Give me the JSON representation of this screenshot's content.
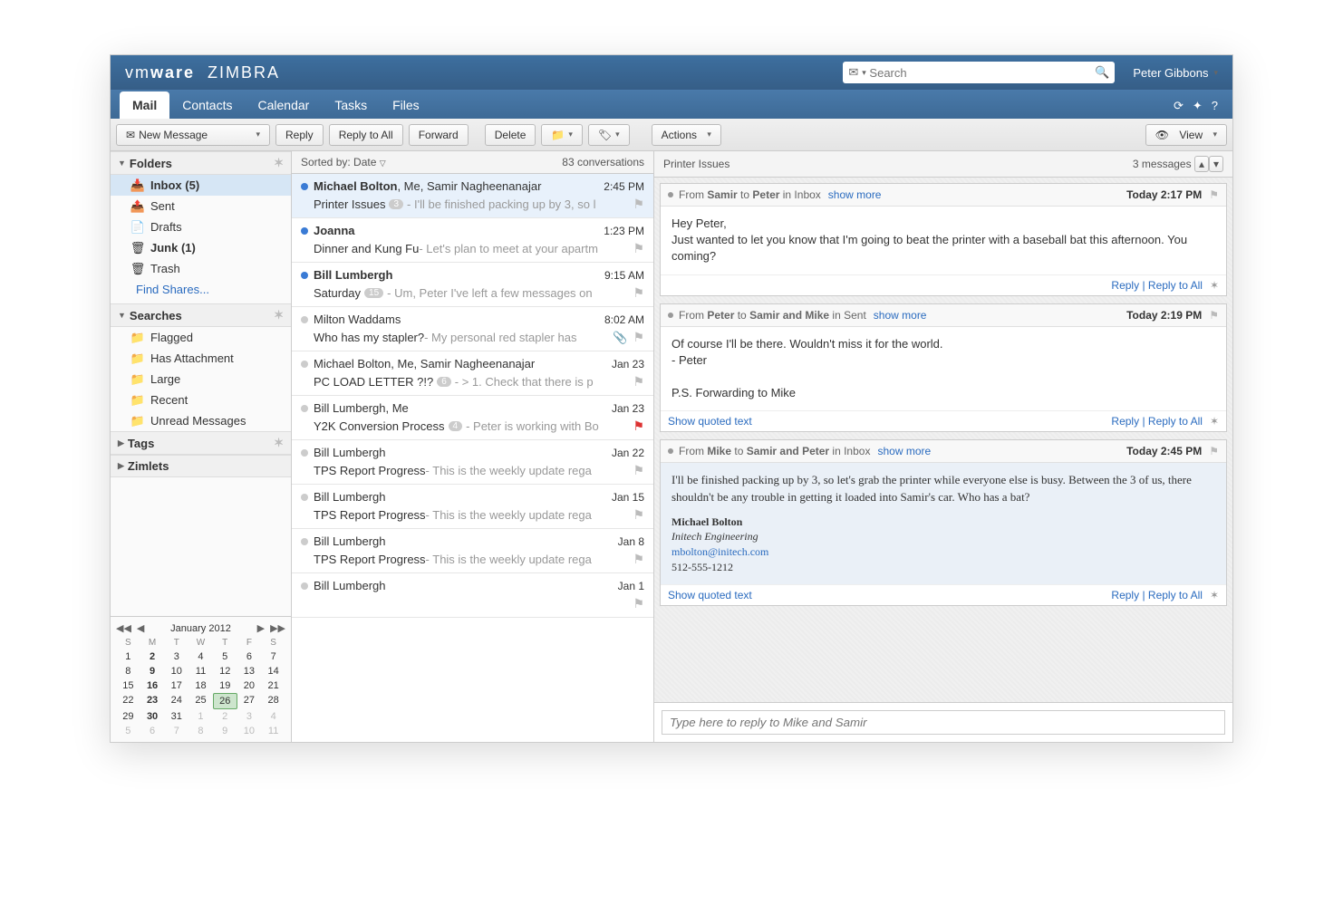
{
  "brand": {
    "prefix": "vm",
    "bold": "ware",
    "suffix": "ZIMBRA"
  },
  "search": {
    "placeholder": "Search"
  },
  "user": {
    "name": "Peter Gibbons"
  },
  "nav": {
    "tabs": [
      "Mail",
      "Contacts",
      "Calendar",
      "Tasks",
      "Files"
    ],
    "active": "Mail"
  },
  "toolbar": {
    "new_message": "New Message",
    "reply": "Reply",
    "reply_all": "Reply to All",
    "forward": "Forward",
    "delete": "Delete",
    "actions": "Actions",
    "view": "View"
  },
  "sidebar": {
    "sections": {
      "folders": {
        "label": "Folders"
      },
      "searches": {
        "label": "Searches"
      },
      "tags": {
        "label": "Tags"
      },
      "zimlets": {
        "label": "Zimlets"
      }
    },
    "folders": [
      {
        "name": "Inbox",
        "count": "(5)",
        "icon": "inbox",
        "selected": true
      },
      {
        "name": "Sent",
        "icon": "sent"
      },
      {
        "name": "Drafts",
        "icon": "drafts"
      },
      {
        "name": "Junk",
        "count": "(1)",
        "icon": "junk",
        "bold": true
      },
      {
        "name": "Trash",
        "icon": "trash"
      }
    ],
    "find_shares": "Find Shares...",
    "searches_items": [
      "Flagged",
      "Has Attachment",
      "Large",
      "Recent",
      "Unread Messages"
    ]
  },
  "calendar": {
    "title": "January 2012",
    "dow": [
      "S",
      "M",
      "T",
      "W",
      "T",
      "F",
      "S"
    ],
    "bold_days": [
      2,
      9,
      16,
      23,
      30
    ],
    "today": 26,
    "weeks": [
      [
        1,
        2,
        3,
        4,
        5,
        6,
        7
      ],
      [
        8,
        9,
        10,
        11,
        12,
        13,
        14
      ],
      [
        15,
        16,
        17,
        18,
        19,
        20,
        21
      ],
      [
        22,
        23,
        24,
        25,
        26,
        27,
        28
      ],
      [
        29,
        30,
        31,
        1,
        2,
        3,
        4
      ],
      [
        5,
        6,
        7,
        8,
        9,
        10,
        11
      ]
    ]
  },
  "list": {
    "sort_label": "Sorted by: Date",
    "count": "83 conversations",
    "items": [
      {
        "unread": true,
        "sender_html": "<b>Michael Bolton</b>, Me, Samir Nagheenanajar",
        "time": "2:45 PM",
        "subject": "Printer Issues",
        "badge": "3",
        "fragment": " - I'll be finished packing up by 3, so l",
        "selected": true
      },
      {
        "unread": true,
        "sender_html": "<b>Joanna</b>",
        "time": "1:23 PM",
        "subject": "Dinner and Kung Fu",
        "fragment": " - Let's plan to meet at your apartm"
      },
      {
        "unread": true,
        "sender_html": "<b>Bill Lumbergh</b>",
        "time": "9:15 AM",
        "subject": "Saturday",
        "badge": "15",
        "fragment": " - Um, Peter I've left a few messages on"
      },
      {
        "unread": false,
        "sender_html": "Milton Waddams",
        "time": "8:02 AM",
        "subject": "Who has my stapler?",
        "fragment": " - My personal red stapler has",
        "attach": true
      },
      {
        "unread": false,
        "sender_html": "Michael Bolton, Me, Samir Nagheenanajar",
        "time": "Jan 23",
        "subject": "PC LOAD LETTER ?!?",
        "badge": "6",
        "fragment": " - > 1. Check that there is p"
      },
      {
        "unread": false,
        "sender_html": "Bill Lumbergh, Me",
        "time": "Jan 23",
        "subject": "Y2K Conversion Process",
        "badge": "4",
        "fragment": " - Peter is working with Bo",
        "flag_red": true
      },
      {
        "unread": false,
        "sender_html": "Bill Lumbergh",
        "time": "Jan 22",
        "subject": "TPS Report Progress",
        "fragment": " - This is the weekly update rega"
      },
      {
        "unread": false,
        "sender_html": "Bill Lumbergh",
        "time": "Jan 15",
        "subject": "TPS Report Progress",
        "fragment": " - This is the weekly update rega"
      },
      {
        "unread": false,
        "sender_html": "Bill Lumbergh",
        "time": "Jan 8",
        "subject": "TPS Report Progress",
        "fragment": " - This is the weekly update rega"
      },
      {
        "unread": false,
        "sender_html": "Bill Lumbergh",
        "time": "Jan 1",
        "subject": "",
        "fragment": ""
      }
    ]
  },
  "reader": {
    "title": "Printer Issues",
    "count": "3 messages",
    "messages": [
      {
        "from": "Samir",
        "to": "Peter",
        "folder": "Inbox",
        "show_more": "show more",
        "time": "Today 2:17 PM",
        "body": "Hey Peter,\nJust wanted to let you know that I'm going to beat the printer with a baseball bat this afternoon.  You coming?",
        "reply": "Reply",
        "reply_all": "Reply to All"
      },
      {
        "from": "Peter",
        "to": "Samir and Mike",
        "folder": "Sent",
        "show_more": "show more",
        "time": "Today 2:19 PM",
        "body": "Of course I'll be there.  Wouldn't miss it for the world.\n- Peter\n\nP.S. Forwarding to Mike",
        "quoted": "Show quoted text",
        "reply": "Reply",
        "reply_all": "Reply to All"
      },
      {
        "from": "Mike",
        "to": "Samir and Peter",
        "folder": "Inbox",
        "show_more": "show more",
        "time": "Today 2:45 PM",
        "body": "I'll be finished packing up by 3, so let's grab the printer while everyone else is busy.  Between the 3 of us, there shouldn't be any trouble in getting it loaded into Samir's car.  Who has a bat?",
        "signature": {
          "name": "Michael Bolton",
          "company": "Initech Engineering",
          "email": "mbolton@initech.com",
          "phone": "512-555-1212"
        },
        "quoted": "Show quoted text",
        "reply": "Reply",
        "reply_all": "Reply to All",
        "highlight": true
      }
    ],
    "reply_placeholder": "Type here to reply to Mike and Samir"
  },
  "labels": {
    "from": "From",
    "to": "to",
    "in": "in"
  }
}
